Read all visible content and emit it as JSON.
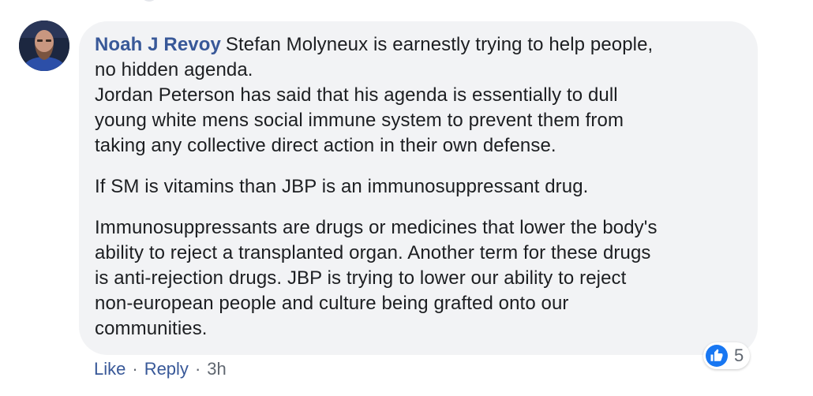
{
  "comment": {
    "author": "Noah J Revoy",
    "paragraphs": [
      "Stefan Molyneux is earnestly trying to help people, no hidden agenda.\nJordan Peterson has said that his agenda is essentially to dull young white mens social immune system to prevent them from taking any collective direct action in their own defense.",
      "If SM is vitamins than JBP is an immunosuppressant drug.",
      "Immunosuppressants are drugs or medicines that lower the body's ability to reject a transplanted organ. Another term for these drugs is anti-rejection drugs. JBP is trying to lower our ability to reject non-european people and culture being grafted onto our communities."
    ],
    "lines_p1": [
      "Stefan Molyneux is earnestly trying to help people,",
      "no hidden agenda.",
      "Jordan Peterson has said that his agenda is essentially to dull",
      "young white mens social immune system to prevent them from",
      "taking any collective direct action in their own defense."
    ],
    "lines_p3": [
      "Immunosuppressants are drugs or medicines that lower the body's",
      "ability to reject a transplanted organ. Another term for these drugs",
      "is anti-rejection drugs. JBP is trying to lower our ability to reject",
      "non-european people and culture being grafted onto our",
      "communities."
    ]
  },
  "actions": {
    "like_label": "Like",
    "separator": "·",
    "reply_label": "Reply",
    "timestamp": "3h"
  },
  "reactions": {
    "icon": "thumbs-up-icon",
    "count": "5",
    "color": "#1877f2"
  },
  "colors": {
    "author": "#385898",
    "bubble": "#f2f3f5",
    "text": "#1c1e21",
    "meta": "#606770"
  }
}
